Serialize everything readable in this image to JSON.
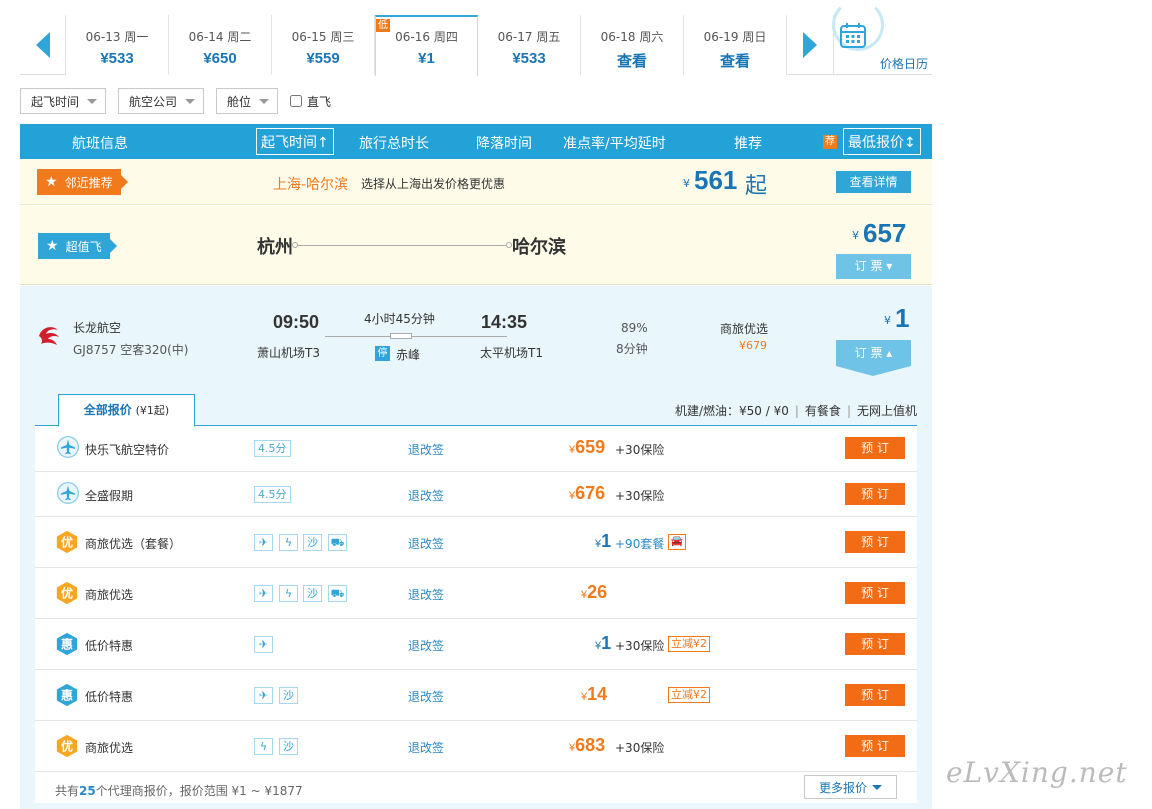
{
  "date_strip": {
    "dates": [
      {
        "date": "06-13",
        "weekday": "周一",
        "price": "¥533"
      },
      {
        "date": "06-14",
        "weekday": "周二",
        "price": "¥650"
      },
      {
        "date": "06-15",
        "weekday": "周三",
        "price": "¥559"
      },
      {
        "date": "06-16",
        "weekday": "周四",
        "price": "¥1",
        "badge": "低"
      },
      {
        "date": "06-17",
        "weekday": "周五",
        "price": "¥533"
      },
      {
        "date": "06-18",
        "weekday": "周六",
        "price": "查看"
      },
      {
        "date": "06-19",
        "weekday": "周日",
        "price": "查看"
      }
    ],
    "calendar_label": "价格日历"
  },
  "filters": {
    "depart_time": "起飞时间",
    "airline": "航空公司",
    "cabin": "舱位",
    "direct": "直飞"
  },
  "table_header": {
    "flight_info": "航班信息",
    "depart_time": "起飞时间↑",
    "total_duration": "旅行总时长",
    "landing_time": "降落时间",
    "ontime_delay": "准点率/平均延时",
    "recommend": "推荐",
    "rec_badge": "荐",
    "lowest_price": "最低报价↕"
  },
  "nearby": {
    "label": "邻近推荐",
    "route": "上海-哈尔滨",
    "tip": "选择从上海出发价格更优惠",
    "currency": "¥",
    "price": "561",
    "suffix": "起",
    "button": "查看详情"
  },
  "value_fly": {
    "label": "超值飞",
    "from": "杭州",
    "to": "哈尔滨",
    "currency": "¥",
    "price": "657",
    "button": "订 票 ▾"
  },
  "flight": {
    "airline": "长龙航空",
    "number": "GJ8757 空客320(中)",
    "depart_time": "09:50",
    "arrive_time": "14:35",
    "duration": "4小时45分钟",
    "depart_airport": "萧山机场T3",
    "arrive_airport": "太平机场T1",
    "stop_badge": "停",
    "stop": "赤峰",
    "ontime_rate": "89%",
    "avg_delay": "8分钟",
    "rec_name": "商旅优选",
    "rec_price": "¥679",
    "currency": "¥",
    "price": "1",
    "button": "订 票 ▴"
  },
  "fare_panel": {
    "tab_label": "全部报价",
    "tab_sub": "(¥1起)",
    "tax": "机建/燃油：¥50 / ¥0",
    "meal": "有餐食",
    "wifi": "无网上值机",
    "refund_label": "退改签",
    "order_label": "预 订",
    "rows": [
      {
        "name": "快乐飞航空特价",
        "icon": "plane-shield-icon",
        "score": "4.5分",
        "currency": "¥",
        "price": "659",
        "extra": "+30保险"
      },
      {
        "name": "全盛假期",
        "icon": "plane-shield-icon",
        "score": "4.5分",
        "currency": "¥",
        "price": "676",
        "extra": "+30保险"
      },
      {
        "name": "商旅优选（套餐）",
        "icon": "you-badge-icon",
        "icon_text": "优",
        "currency": "¥",
        "price": "1",
        "extra": "+90套餐"
      },
      {
        "name": "商旅优选",
        "icon": "you-badge-icon",
        "icon_text": "优",
        "currency": "¥",
        "price": "26"
      },
      {
        "name": "低价特惠",
        "icon": "hui-badge-icon",
        "icon_text": "惠",
        "currency": "¥",
        "price": "1",
        "extra": "+30保险",
        "discount": "立减¥2"
      },
      {
        "name": "低价特惠",
        "icon": "hui-badge-icon",
        "icon_text": "惠",
        "currency": "¥",
        "price": "14",
        "discount": "立减¥2"
      },
      {
        "name": "商旅优选",
        "icon": "you-badge-icon",
        "icon_text": "优",
        "currency": "¥",
        "price": "683",
        "extra": "+30保险"
      }
    ],
    "footer_prefix": "共有",
    "footer_count": "25",
    "footer_suffix": "个代理商报价，报价范围 ¥1 ~ ¥1877",
    "more_button": "更多报价"
  },
  "watermark": "eLvXing.net",
  "colors": {
    "accent_blue": "#23a2d8",
    "price_blue": "#1a75b5",
    "orange": "#f07a1c",
    "highlight_bg": "#fefbe8",
    "flight_bg": "#e9f6fb"
  }
}
